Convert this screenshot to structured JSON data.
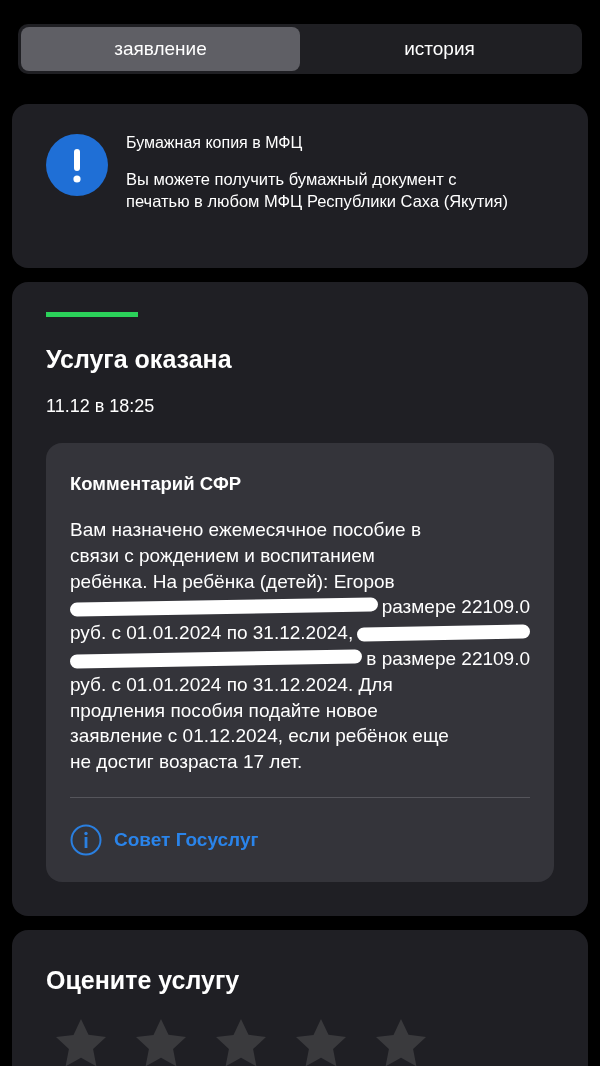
{
  "tabs": [
    {
      "label": "заявление",
      "selected": true
    },
    {
      "label": "история",
      "selected": false
    }
  ],
  "notice": {
    "title": "Бумажная копия в МФЦ",
    "text": "Вы можете получить бумажный документ с печатью в любом МФЦ Республики Саха (Якутия)"
  },
  "status": {
    "level": 1,
    "title": "Услуга оказана",
    "time": "11.12 в 18:25"
  },
  "comment": {
    "title": "Комментарий СФР",
    "lines": [
      [
        {
          "kind": "text",
          "text": "Вам назначено ежемесячное пособие в"
        }
      ],
      [
        {
          "kind": "text",
          "text": "связи с рождением и воспитанием"
        }
      ],
      [
        {
          "kind": "text",
          "text": "ребёнка. На ребёнка (детей): Егоров"
        }
      ],
      [
        {
          "kind": "redacted"
        },
        {
          "kind": "text",
          "text": "размере 22109.0"
        }
      ],
      [
        {
          "kind": "text",
          "text": "руб. с 01.01.2024 по 31.12.2024,"
        },
        {
          "kind": "redacted"
        }
      ],
      [
        {
          "kind": "redacted"
        },
        {
          "kind": "text",
          "text": "в размере 22109.0"
        }
      ],
      [
        {
          "kind": "text",
          "text": "руб. с 01.01.2024 по 31.12.2024. Для"
        }
      ],
      [
        {
          "kind": "text",
          "text": "продления пособия подайте новое"
        }
      ],
      [
        {
          "kind": "text",
          "text": "заявление с 01.12.2024, если ребёнок еще"
        }
      ],
      [
        {
          "kind": "text",
          "text": "не достиг возраста 17 лет."
        }
      ]
    ],
    "link": "Совет Госуслуг"
  },
  "rating": {
    "title": "Оцените услугу",
    "stars": 0
  }
}
